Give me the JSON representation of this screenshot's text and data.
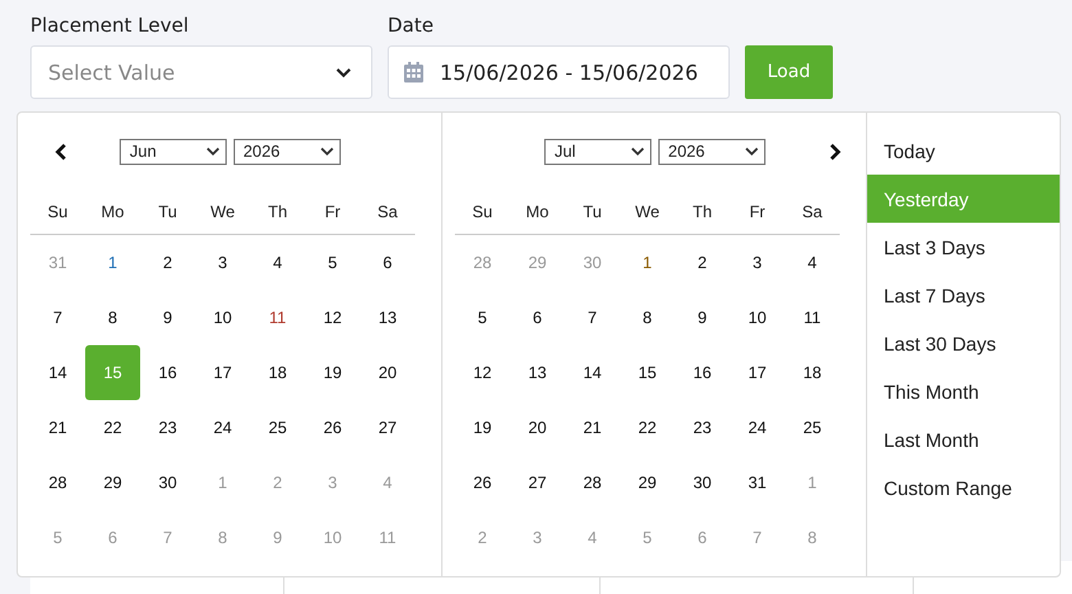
{
  "filters": {
    "placement_label": "Placement Level",
    "placement_placeholder": "Select Value",
    "date_label": "Date",
    "date_value": "15/06/2026 - 15/06/2026",
    "load_button": "Load"
  },
  "calendars": [
    {
      "month": "Jun",
      "year": "2026",
      "prev_button": true,
      "weekdays": [
        "Su",
        "Mo",
        "Tu",
        "We",
        "Th",
        "Fr",
        "Sa"
      ],
      "weeks": [
        [
          {
            "d": "31",
            "other": true,
            "selected": false
          },
          {
            "d": "1",
            "other": false,
            "selected": false,
            "color": "#1f6fb5"
          },
          {
            "d": "2",
            "other": false,
            "selected": false
          },
          {
            "d": "3",
            "other": false,
            "selected": false
          },
          {
            "d": "4",
            "other": false,
            "selected": false
          },
          {
            "d": "5",
            "other": false,
            "selected": false
          },
          {
            "d": "6",
            "other": false,
            "selected": false
          }
        ],
        [
          {
            "d": "7",
            "other": false,
            "selected": false
          },
          {
            "d": "8",
            "other": false,
            "selected": false
          },
          {
            "d": "9",
            "other": false,
            "selected": false
          },
          {
            "d": "10",
            "other": false,
            "selected": false
          },
          {
            "d": "11",
            "other": false,
            "selected": false,
            "color": "#b03a2e"
          },
          {
            "d": "12",
            "other": false,
            "selected": false
          },
          {
            "d": "13",
            "other": false,
            "selected": false
          }
        ],
        [
          {
            "d": "14",
            "other": false,
            "selected": false
          },
          {
            "d": "15",
            "other": false,
            "selected": true
          },
          {
            "d": "16",
            "other": false,
            "selected": false
          },
          {
            "d": "17",
            "other": false,
            "selected": false
          },
          {
            "d": "18",
            "other": false,
            "selected": false
          },
          {
            "d": "19",
            "other": false,
            "selected": false
          },
          {
            "d": "20",
            "other": false,
            "selected": false
          }
        ],
        [
          {
            "d": "21",
            "other": false,
            "selected": false
          },
          {
            "d": "22",
            "other": false,
            "selected": false
          },
          {
            "d": "23",
            "other": false,
            "selected": false
          },
          {
            "d": "24",
            "other": false,
            "selected": false
          },
          {
            "d": "25",
            "other": false,
            "selected": false
          },
          {
            "d": "26",
            "other": false,
            "selected": false
          },
          {
            "d": "27",
            "other": false,
            "selected": false
          }
        ],
        [
          {
            "d": "28",
            "other": false,
            "selected": false
          },
          {
            "d": "29",
            "other": false,
            "selected": false
          },
          {
            "d": "30",
            "other": false,
            "selected": false
          },
          {
            "d": "1",
            "other": true,
            "selected": false
          },
          {
            "d": "2",
            "other": true,
            "selected": false
          },
          {
            "d": "3",
            "other": true,
            "selected": false
          },
          {
            "d": "4",
            "other": true,
            "selected": false
          }
        ],
        [
          {
            "d": "5",
            "other": true,
            "selected": false
          },
          {
            "d": "6",
            "other": true,
            "selected": false
          },
          {
            "d": "7",
            "other": true,
            "selected": false
          },
          {
            "d": "8",
            "other": true,
            "selected": false
          },
          {
            "d": "9",
            "other": true,
            "selected": false
          },
          {
            "d": "10",
            "other": true,
            "selected": false
          },
          {
            "d": "11",
            "other": true,
            "selected": false
          }
        ]
      ]
    },
    {
      "month": "Jul",
      "year": "2026",
      "next_button": true,
      "weekdays": [
        "Su",
        "Mo",
        "Tu",
        "We",
        "Th",
        "Fr",
        "Sa"
      ],
      "weeks": [
        [
          {
            "d": "28",
            "other": true,
            "selected": false
          },
          {
            "d": "29",
            "other": true,
            "selected": false
          },
          {
            "d": "30",
            "other": true,
            "selected": false
          },
          {
            "d": "1",
            "other": false,
            "selected": false,
            "color": "#8a5a00"
          },
          {
            "d": "2",
            "other": false,
            "selected": false
          },
          {
            "d": "3",
            "other": false,
            "selected": false
          },
          {
            "d": "4",
            "other": false,
            "selected": false
          }
        ],
        [
          {
            "d": "5",
            "other": false,
            "selected": false
          },
          {
            "d": "6",
            "other": false,
            "selected": false
          },
          {
            "d": "7",
            "other": false,
            "selected": false
          },
          {
            "d": "8",
            "other": false,
            "selected": false
          },
          {
            "d": "9",
            "other": false,
            "selected": false
          },
          {
            "d": "10",
            "other": false,
            "selected": false
          },
          {
            "d": "11",
            "other": false,
            "selected": false
          }
        ],
        [
          {
            "d": "12",
            "other": false,
            "selected": false
          },
          {
            "d": "13",
            "other": false,
            "selected": false
          },
          {
            "d": "14",
            "other": false,
            "selected": false
          },
          {
            "d": "15",
            "other": false,
            "selected": false
          },
          {
            "d": "16",
            "other": false,
            "selected": false
          },
          {
            "d": "17",
            "other": false,
            "selected": false
          },
          {
            "d": "18",
            "other": false,
            "selected": false
          }
        ],
        [
          {
            "d": "19",
            "other": false,
            "selected": false
          },
          {
            "d": "20",
            "other": false,
            "selected": false
          },
          {
            "d": "21",
            "other": false,
            "selected": false
          },
          {
            "d": "22",
            "other": false,
            "selected": false
          },
          {
            "d": "23",
            "other": false,
            "selected": false
          },
          {
            "d": "24",
            "other": false,
            "selected": false
          },
          {
            "d": "25",
            "other": false,
            "selected": false
          }
        ],
        [
          {
            "d": "26",
            "other": false,
            "selected": false
          },
          {
            "d": "27",
            "other": false,
            "selected": false
          },
          {
            "d": "28",
            "other": false,
            "selected": false
          },
          {
            "d": "29",
            "other": false,
            "selected": false
          },
          {
            "d": "30",
            "other": false,
            "selected": false
          },
          {
            "d": "31",
            "other": false,
            "selected": false
          },
          {
            "d": "1",
            "other": true,
            "selected": false
          }
        ],
        [
          {
            "d": "2",
            "other": true,
            "selected": false
          },
          {
            "d": "3",
            "other": true,
            "selected": false
          },
          {
            "d": "4",
            "other": true,
            "selected": false
          },
          {
            "d": "5",
            "other": true,
            "selected": false
          },
          {
            "d": "6",
            "other": true,
            "selected": false
          },
          {
            "d": "7",
            "other": true,
            "selected": false
          },
          {
            "d": "8",
            "other": true,
            "selected": false
          }
        ]
      ]
    }
  ],
  "ranges": [
    {
      "label": "Today",
      "selected": false
    },
    {
      "label": "Yesterday",
      "selected": true
    },
    {
      "label": "Last 3 Days",
      "selected": false
    },
    {
      "label": "Last 7 Days",
      "selected": false
    },
    {
      "label": "Last 30 Days",
      "selected": false
    },
    {
      "label": "This Month",
      "selected": false
    },
    {
      "label": "Last Month",
      "selected": false
    },
    {
      "label": "Custom Range",
      "selected": false
    }
  ]
}
